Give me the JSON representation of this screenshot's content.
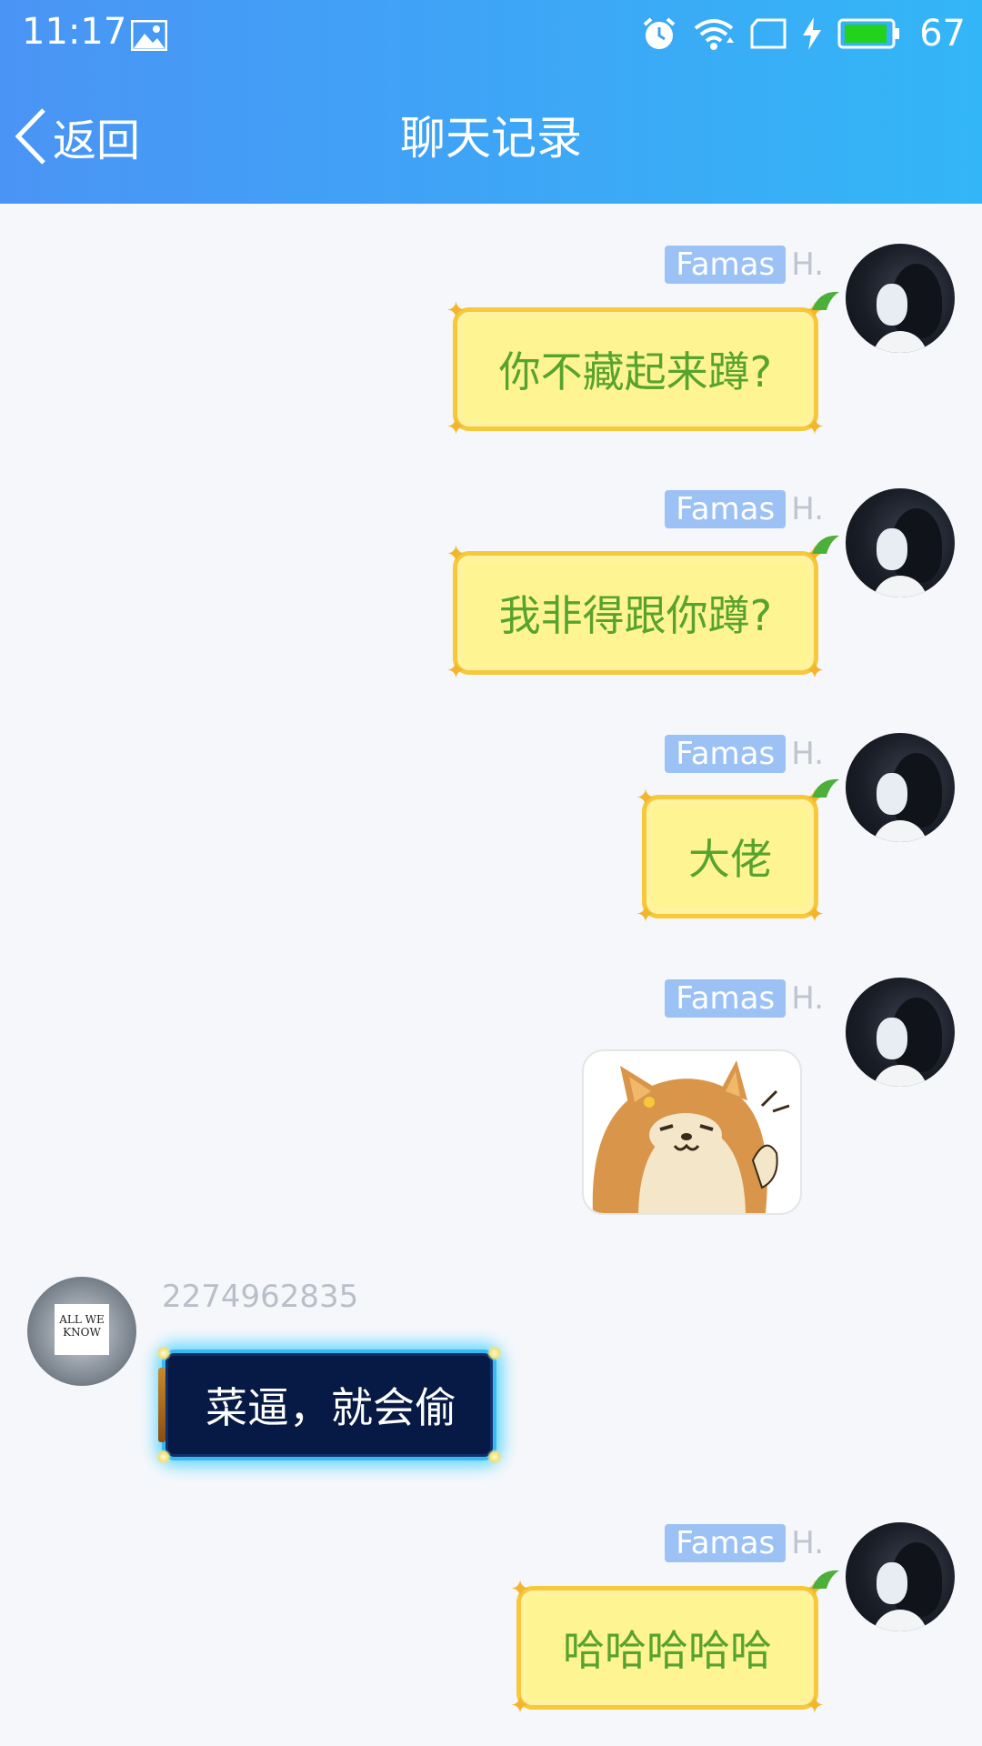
{
  "status_bar": {
    "time": "11:17",
    "battery": "67",
    "icons": [
      "image-icon",
      "alarm-icon",
      "wifi-icon",
      "sim-card-icon",
      "charging-icon",
      "battery-icon"
    ]
  },
  "nav": {
    "back_label": "返回",
    "title": "聊天记录"
  },
  "colors": {
    "header_start": "#4a94f5",
    "header_end": "#33b6f7",
    "bubble_yellow": "#fef592",
    "bubble_text_green": "#58a22e",
    "name_pill": "#9cc1f5",
    "dark_bubble": "#071a45",
    "dark_bubble_glow": "#5bd6ff"
  },
  "messages": [
    {
      "sender_name": "Famas",
      "sender_suffix": "H.",
      "text": "你不藏起来蹲?"
    },
    {
      "sender_name": "Famas",
      "sender_suffix": "H.",
      "text": "我非得跟你蹲?"
    },
    {
      "sender_name": "Famas",
      "sender_suffix": "H.",
      "text": "大佬"
    },
    {
      "sender_name": "Famas",
      "sender_suffix": "H.",
      "sticker": "shiba-dog-sticker"
    },
    {
      "sender_id": "2274962835",
      "avatar_text": "ALL WE KNOW",
      "text": "菜逼，就会偷"
    },
    {
      "sender_name": "Famas",
      "sender_suffix": "H.",
      "text": "哈哈哈哈哈"
    }
  ]
}
